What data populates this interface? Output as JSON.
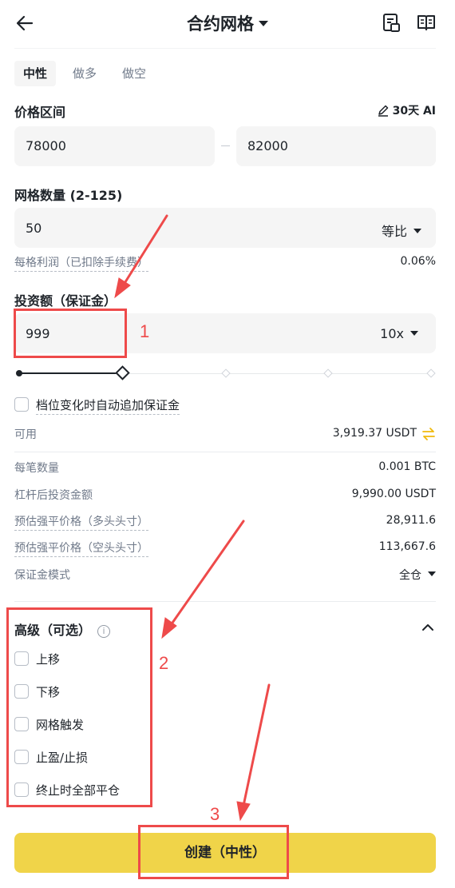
{
  "header": {
    "title": "合约网格",
    "back_icon": "back-arrow-icon",
    "icons": [
      "order-history-icon",
      "guide-book-icon"
    ]
  },
  "mode_tabs": [
    {
      "label": "中性",
      "active": true
    },
    {
      "label": "做多",
      "active": false
    },
    {
      "label": "做空",
      "active": false
    }
  ],
  "price_range": {
    "label": "价格区间",
    "ai_label": "30天 AI",
    "low": "78000",
    "high": "82000"
  },
  "grid": {
    "label": "网格数量 (2-125)",
    "value": "50",
    "mode": "等比",
    "profit_label": "每格利润（已扣除手续费）",
    "profit_value": "0.06%"
  },
  "investment": {
    "label": "投资额（保证金）",
    "value": "999",
    "leverage": "10x",
    "slider_fraction": 0.25,
    "auto_margin_label": "档位变化时自动追加保证金"
  },
  "details": {
    "available_label": "可用",
    "available_value": "3,919.37 USDT",
    "per_order_label": "每笔数量",
    "per_order_value": "0.001 BTC",
    "leveraged_label": "杠杆后投资金额",
    "leveraged_value": "9,990.00 USDT",
    "liq_long_label": "预估强平价格（多头头寸）",
    "liq_long_value": "28,911.6",
    "liq_short_label": "预估强平价格（空头头寸）",
    "liq_short_value": "113,667.6",
    "margin_mode_label": "保证金模式",
    "margin_mode_value": "全仓"
  },
  "advanced": {
    "label": "高级（可选）",
    "options": [
      "上移",
      "下移",
      "网格触发",
      "止盈/止损",
      "终止时全部平仓"
    ]
  },
  "submit": {
    "label": "创建（中性）"
  },
  "annotations": [
    "1",
    "2",
    "3"
  ],
  "colors": {
    "accent_yellow": "#F0D449",
    "annotation_red": "#EE4A4A",
    "field_bg": "#F5F5F5",
    "swap_icon": "#F0B90B"
  }
}
